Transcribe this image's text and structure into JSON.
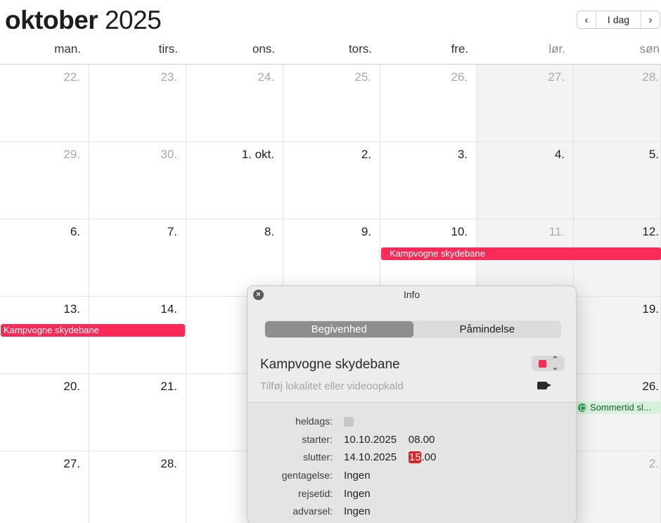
{
  "header": {
    "month": "oktober",
    "year": "2025",
    "today_label": "I dag",
    "prev_icon": "‹",
    "next_icon": "›"
  },
  "weekdays": [
    "man.",
    "tirs.",
    "ons.",
    "tors.",
    "fre.",
    "lør.",
    "søn"
  ],
  "weeks": [
    [
      "22.",
      "23.",
      "24.",
      "25.",
      "26.",
      "27.",
      "28."
    ],
    [
      "29.",
      "30.",
      "1. okt.",
      "2.",
      "3.",
      "4.",
      "5."
    ],
    [
      "6.",
      "7.",
      "8.",
      "9.",
      "10.",
      "11.",
      "12."
    ],
    [
      "13.",
      "14.",
      "",
      "",
      "",
      "",
      "19."
    ],
    [
      "20.",
      "21.",
      "",
      "",
      "",
      "",
      "26."
    ],
    [
      "27.",
      "28.",
      "",
      "",
      "",
      "",
      "2."
    ]
  ],
  "events": {
    "bar1_label": "Kampvogne skydebane",
    "bar2_label": "Kampvogne skydebane",
    "green_label": "Sommertid sl...",
    "event_color": "#fb2b58",
    "green_color": "#2ea44f"
  },
  "popover": {
    "title": "Info",
    "tabs": [
      "Begivenhed",
      "Påmindelse"
    ],
    "event_title": "Kampvogne skydebane",
    "location_placeholder": "Tilføj lokalitet eller videoopkald",
    "rows": {
      "allday_label": "heldags:",
      "start_label": "starter:",
      "start_date": "10.10.2025",
      "start_time": "08.00",
      "end_label": "slutter:",
      "end_date": "14.10.2025",
      "end_hour": "15",
      "end_rest": ".00",
      "repeat_label": "gentagelse:",
      "repeat_value": "Ingen",
      "travel_label": "rejsetid:",
      "travel_value": "Ingen",
      "alert_label": "advarsel:",
      "alert_value": "Ingen"
    }
  }
}
